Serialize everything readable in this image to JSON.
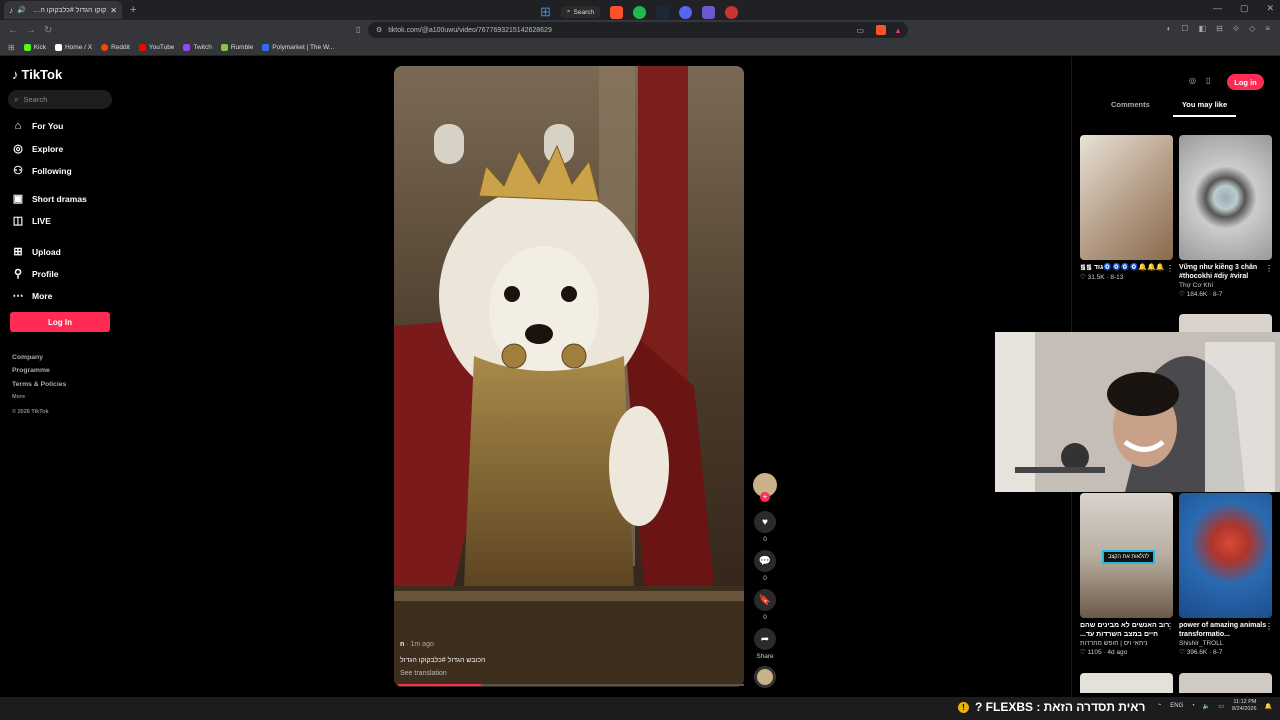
{
  "browser": {
    "tab_title": "קוקו הגדול #כלבקוקו הכובש הגדול",
    "url": "tiktok.com/@a100uwu/video/7677693215142628629",
    "bookmarks": [
      "Kick",
      "Home / X",
      "Reddit",
      "YouTube",
      "Twitch",
      "Rumble",
      "Polymarket | The W..."
    ],
    "bookmark_colors": [
      "#53fc18",
      "#ffffff",
      "#ff4500",
      "#ff0000",
      "#9146ff",
      "#85c742",
      "#2f6cf6"
    ]
  },
  "sidebar": {
    "logo": "TikTok",
    "search_placeholder": "Search",
    "items": [
      {
        "label": "For You",
        "icon": "home-icon"
      },
      {
        "label": "Explore",
        "icon": "compass-icon"
      },
      {
        "label": "Following",
        "icon": "following-icon"
      },
      {
        "label": "Short dramas",
        "icon": "drama-icon"
      },
      {
        "label": "LIVE",
        "icon": "live-icon"
      },
      {
        "label": "Upload",
        "icon": "upload-icon"
      },
      {
        "label": "Profile",
        "icon": "profile-icon"
      },
      {
        "label": "More",
        "icon": "more-icon"
      }
    ],
    "login": "Log In",
    "footer": {
      "company": "Company",
      "programme": "Programme",
      "terms": "Terms & Policies",
      "more": "More",
      "copyright": "© 2026 TikTok"
    }
  },
  "video": {
    "author": "n",
    "time": "· 1m ago",
    "caption": "הכובש הגדול #כלבקוקו הגדול",
    "see_translation": "See translation",
    "progress": 0.24,
    "likes": "0",
    "comments": "0",
    "saves": "0",
    "share_label": "Share"
  },
  "right_panel": {
    "login": "Log in",
    "tabs": [
      "Comments",
      "You may like"
    ],
    "cards": [
      {
        "caption": "᯾᯾ גוד🧿🧿🧿🧿🔔🔔🔔",
        "author": "",
        "stats": "♡ 31.5K · 8-13"
      },
      {
        "caption": "Vững như kiềng 3 chân #thocokhi #diy #viral",
        "author": "Thợ Cơ Khí",
        "stats": "♡ 184.6K · 8-7"
      },
      {
        "caption": "רוב האנשים לא מבינים שהם חיים במצב השרדות עד...",
        "author": "ניתאי ויס | חופש מחרדות",
        "stats": "♡ 1105 · 4d ago"
      },
      {
        "caption": "power of amazing animals transformatio...",
        "author": "Shishir_TROLL",
        "stats": "♡ 396.6K · 8-7"
      }
    ],
    "card3_overlay": "להלאות את הקצב"
  },
  "ticker": {
    "text": "ראית תסדרה הזאת : FLEXBS ?",
    "brand": "FLEXBS"
  },
  "taskbar": {
    "search": "Search",
    "lang": "ENG",
    "time": "11:12 PM",
    "date": "8/24/2026"
  }
}
